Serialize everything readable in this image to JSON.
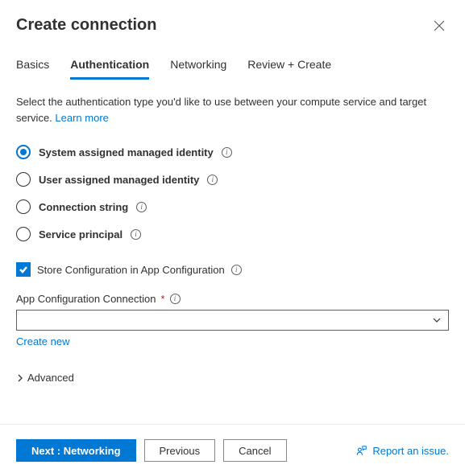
{
  "header": {
    "title": "Create connection"
  },
  "tabs": {
    "items": [
      {
        "label": "Basics"
      },
      {
        "label": "Authentication"
      },
      {
        "label": "Networking"
      },
      {
        "label": "Review + Create"
      }
    ]
  },
  "description": {
    "text": "Select the authentication type you'd like to use between your compute service and target service. ",
    "learn_more": "Learn more"
  },
  "auth_options": {
    "items": [
      {
        "label": "System assigned managed identity"
      },
      {
        "label": "User assigned managed identity"
      },
      {
        "label": "Connection string"
      },
      {
        "label": "Service principal"
      }
    ]
  },
  "store_config": {
    "label": "Store Configuration in App Configuration"
  },
  "app_config": {
    "label": "App Configuration Connection",
    "create_new": "Create new"
  },
  "advanced": {
    "label": "Advanced"
  },
  "footer": {
    "next": "Next : Networking",
    "previous": "Previous",
    "cancel": "Cancel",
    "report": "Report an issue."
  }
}
